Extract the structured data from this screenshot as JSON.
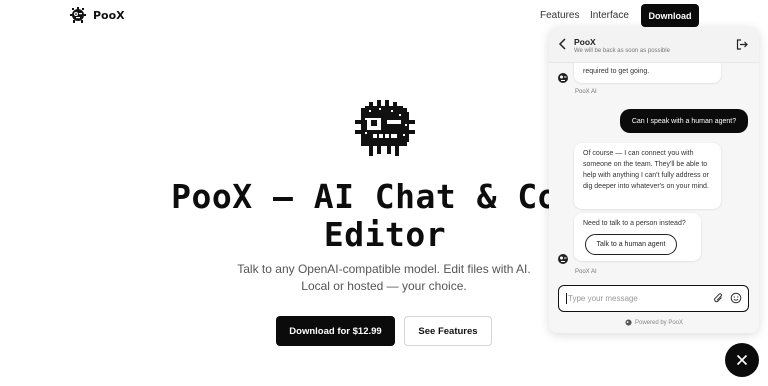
{
  "nav": {
    "brand": "PooX",
    "links": [
      "Features",
      "Interface"
    ],
    "download_label": "Download"
  },
  "hero": {
    "title_line1": "PooX — AI Chat & Code",
    "title_line2": "Editor",
    "subtitle": "Talk to any OpenAI-compatible model. Edit files with AI. Local or hosted — your choice.",
    "primary_cta": "Download for $12.99",
    "secondary_cta": "See Features"
  },
  "chat": {
    "title": "PooX",
    "subtitle": "We will be back as soon as possible",
    "partial_message": "required to get going.",
    "bot_name": "PooX AI",
    "user_message": "Can I speak with a human agent?",
    "reply_message": "Of course — I can connect you with someone on the team. They'll be able to help with anything I can't fully address or dig deeper into whatever's on your mind.",
    "handoff_prompt": "Need to talk to a person instead?",
    "handoff_button": "Talk to a human agent",
    "input_placeholder": "Type your message",
    "powered_by": "Powered by PooX"
  },
  "colors": {
    "primary": "#0b0b0b",
    "background": "#ffffff",
    "chat_background": "#f6f6f6"
  },
  "icons": {
    "logo": "poox-mascot-icon",
    "back": "chevron-left-icon",
    "exit": "exit-chat-icon",
    "attach": "paperclip-icon",
    "emoji": "smiley-icon",
    "close": "close-icon"
  }
}
